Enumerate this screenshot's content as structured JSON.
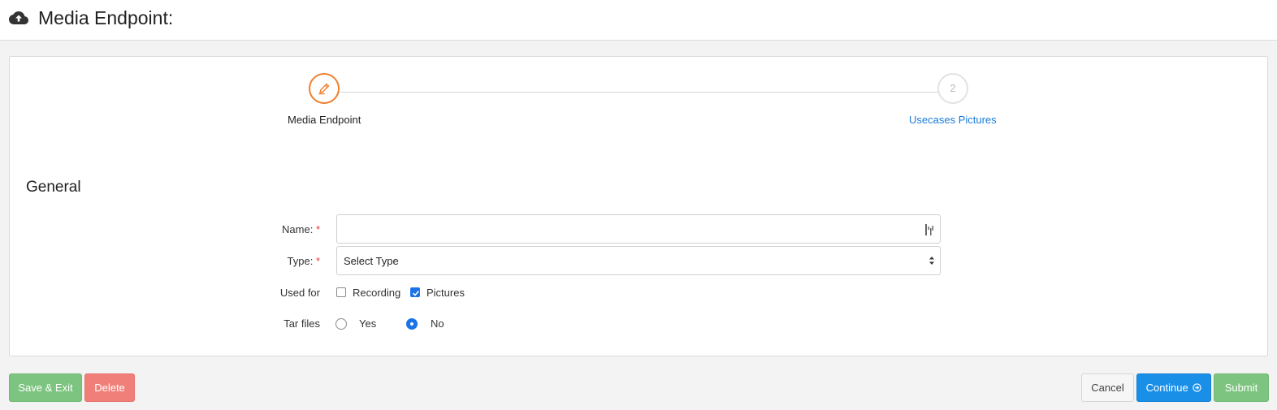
{
  "header": {
    "title": "Media Endpoint:",
    "icon": "cloud-upload-icon"
  },
  "stepper": {
    "steps": [
      {
        "label": "Media Endpoint",
        "icon": "pencil-icon",
        "state": "active"
      },
      {
        "label": "Usecases Pictures",
        "number": "2",
        "state": "pending"
      }
    ],
    "active_color": "#f0802e",
    "link_color": "#1a7cd6"
  },
  "section": {
    "title": "General"
  },
  "form": {
    "name": {
      "label": "Name:",
      "required_mark": "*",
      "value": ""
    },
    "type": {
      "label": "Type:",
      "required_mark": "*",
      "selected": "Select Type"
    },
    "used_for": {
      "label": "Used for",
      "options": [
        {
          "label": "Recording",
          "checked": false
        },
        {
          "label": "Pictures",
          "checked": true
        }
      ]
    },
    "tar_files": {
      "label": "Tar files",
      "options": [
        {
          "label": "Yes",
          "selected": false
        },
        {
          "label": "No",
          "selected": true
        }
      ]
    }
  },
  "footer": {
    "save_exit": "Save & Exit",
    "delete": "Delete",
    "cancel": "Cancel",
    "continue": "Continue",
    "submit": "Submit"
  },
  "colors": {
    "green": "#7cc47f",
    "red": "#f17f79",
    "blue": "#1a8fe8",
    "required": "#e53935"
  }
}
